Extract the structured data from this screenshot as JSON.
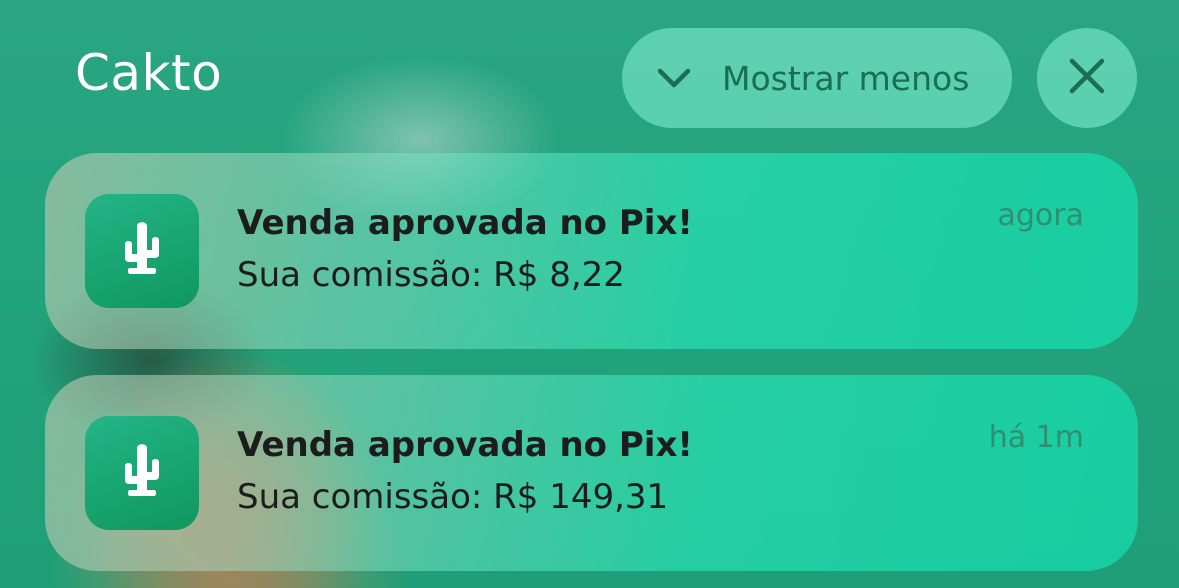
{
  "header": {
    "app_name": "Cakto",
    "show_less_label": "Mostrar menos",
    "show_less_icon": "chevron-down-icon",
    "close_icon": "close-icon"
  },
  "notifications": [
    {
      "title": "Venda aprovada no Pix!",
      "body": "Sua comissão: R$ 8,22",
      "time": "agora",
      "icon": "cactus-icon"
    },
    {
      "title": "Venda aprovada no Pix!",
      "body": "Sua comissão: R$ 149,31",
      "time": "há 1m",
      "icon": "cactus-icon"
    }
  ],
  "colors": {
    "background": "#22a47c",
    "pill": "#78e6c8",
    "app_icon": "#10975f",
    "text_dark": "#1c1c1c",
    "time_text": "#2f8f6f"
  }
}
